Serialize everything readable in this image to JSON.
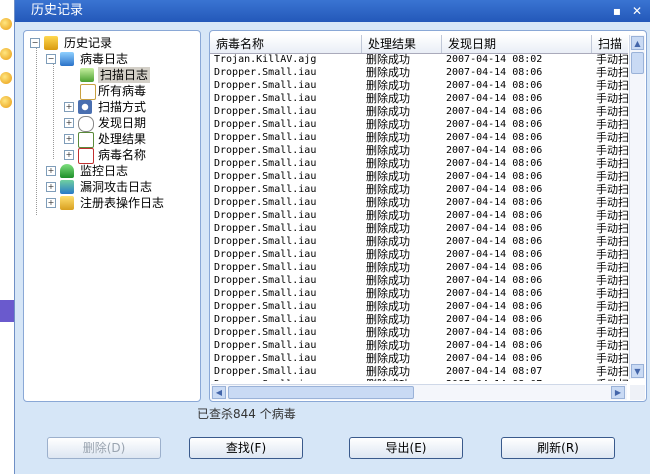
{
  "window": {
    "title": "历史记录"
  },
  "tree": {
    "root": "历史记录",
    "virus_log": "病毒日志",
    "scan_log": "扫描日志",
    "all_viruses": "所有病毒",
    "scan_method": "扫描方式",
    "found_date": "发现日期",
    "result": "处理结果",
    "virus_name": "病毒名称",
    "monitor_log": "监控日志",
    "exploit_log": "漏洞攻击日志",
    "registry_log": "注册表操作日志"
  },
  "table": {
    "columns": [
      "病毒名称",
      "处理结果",
      "发现日期",
      "扫描方式"
    ],
    "rows": [
      [
        "Trojan.KillAV.ajg",
        "删除成功",
        "2007-04-14 08:02",
        "手动扫描"
      ],
      [
        "Dropper.Small.iau",
        "删除成功",
        "2007-04-14 08:06",
        "手动扫描"
      ],
      [
        "Dropper.Small.iau",
        "删除成功",
        "2007-04-14 08:06",
        "手动扫描"
      ],
      [
        "Dropper.Small.iau",
        "删除成功",
        "2007-04-14 08:06",
        "手动扫描"
      ],
      [
        "Dropper.Small.iau",
        "删除成功",
        "2007-04-14 08:06",
        "手动扫描"
      ],
      [
        "Dropper.Small.iau",
        "删除成功",
        "2007-04-14 08:06",
        "手动扫描"
      ],
      [
        "Dropper.Small.iau",
        "删除成功",
        "2007-04-14 08:06",
        "手动扫描"
      ],
      [
        "Dropper.Small.iau",
        "删除成功",
        "2007-04-14 08:06",
        "手动扫描"
      ],
      [
        "Dropper.Small.iau",
        "删除成功",
        "2007-04-14 08:06",
        "手动扫描"
      ],
      [
        "Dropper.Small.iau",
        "删除成功",
        "2007-04-14 08:06",
        "手动扫描"
      ],
      [
        "Dropper.Small.iau",
        "删除成功",
        "2007-04-14 08:06",
        "手动扫描"
      ],
      [
        "Dropper.Small.iau",
        "删除成功",
        "2007-04-14 08:06",
        "手动扫描"
      ],
      [
        "Dropper.Small.iau",
        "删除成功",
        "2007-04-14 08:06",
        "手动扫描"
      ],
      [
        "Dropper.Small.iau",
        "删除成功",
        "2007-04-14 08:06",
        "手动扫描"
      ],
      [
        "Dropper.Small.iau",
        "删除成功",
        "2007-04-14 08:06",
        "手动扫描"
      ],
      [
        "Dropper.Small.iau",
        "删除成功",
        "2007-04-14 08:06",
        "手动扫描"
      ],
      [
        "Dropper.Small.iau",
        "删除成功",
        "2007-04-14 08:06",
        "手动扫描"
      ],
      [
        "Dropper.Small.iau",
        "删除成功",
        "2007-04-14 08:06",
        "手动扫描"
      ],
      [
        "Dropper.Small.iau",
        "删除成功",
        "2007-04-14 08:06",
        "手动扫描"
      ],
      [
        "Dropper.Small.iau",
        "删除成功",
        "2007-04-14 08:06",
        "手动扫描"
      ],
      [
        "Dropper.Small.iau",
        "删除成功",
        "2007-04-14 08:06",
        "手动扫描"
      ],
      [
        "Dropper.Small.iau",
        "删除成功",
        "2007-04-14 08:06",
        "手动扫描"
      ],
      [
        "Dropper.Small.iau",
        "删除成功",
        "2007-04-14 08:06",
        "手动扫描"
      ],
      [
        "Dropper.Small.iau",
        "删除成功",
        "2007-04-14 08:06",
        "手动扫描"
      ],
      [
        "Dropper.Small.iau",
        "删除成功",
        "2007-04-14 08:07",
        "手动扫描"
      ],
      [
        "Dropper.Small.iau",
        "删除成功",
        "2007-04-14 08:07",
        "手动扫描"
      ],
      [
        "Dropper.Small.iau",
        "删除成功",
        "2007-04-14 08:07",
        "手动扫描"
      ],
      [
        "Dropper.Small.iau",
        "删除成功",
        "2007-04-14 08:07",
        "手动扫描"
      ],
      [
        "Dropper.Small.iau",
        "删除成功",
        "2007-04-14 08:07",
        "手动扫描"
      ]
    ]
  },
  "status": {
    "text": "已查杀844 个病毒"
  },
  "buttons": {
    "delete": "删除(D)",
    "find": "查找(F)",
    "export": "导出(E)",
    "refresh": "刷新(R)"
  },
  "colors": {
    "title_bar": "#2f66c8",
    "dialog_bg": "#d6e6f7",
    "panel_border": "#8aa8d6"
  }
}
